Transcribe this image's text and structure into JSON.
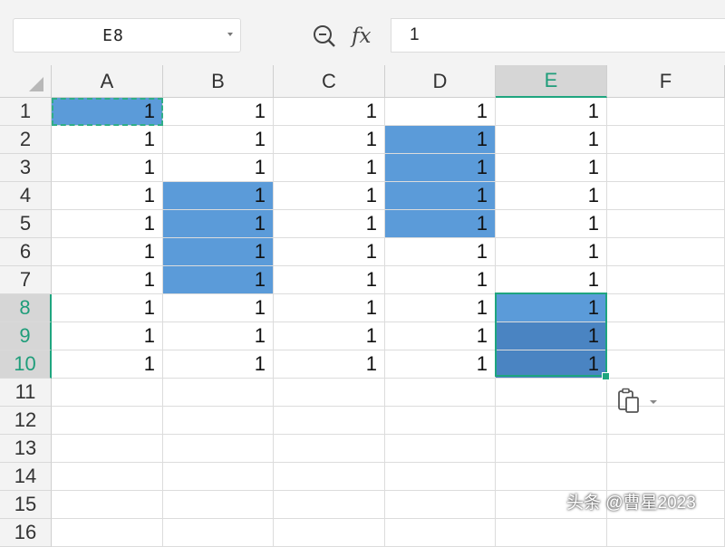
{
  "toolbar": {
    "name_box_value": "E8",
    "formula_value": "1",
    "zoom_icon": "magnifier-zoom-icon",
    "fx_label": "fx"
  },
  "sheet": {
    "columns": [
      "A",
      "B",
      "C",
      "D",
      "E",
      "F"
    ],
    "active_column": "E",
    "rows": [
      "1",
      "2",
      "3",
      "4",
      "5",
      "6",
      "7",
      "8",
      "9",
      "10",
      "11",
      "12",
      "13",
      "14",
      "15",
      "16"
    ],
    "active_rows": [
      "8",
      "9",
      "10"
    ],
    "cells": [
      [
        "1",
        "1",
        "1",
        "1",
        "1",
        ""
      ],
      [
        "1",
        "1",
        "1",
        "1",
        "1",
        ""
      ],
      [
        "1",
        "1",
        "1",
        "1",
        "1",
        ""
      ],
      [
        "1",
        "1",
        "1",
        "1",
        "1",
        ""
      ],
      [
        "1",
        "1",
        "1",
        "1",
        "1",
        ""
      ],
      [
        "1",
        "1",
        "1",
        "1",
        "1",
        ""
      ],
      [
        "1",
        "1",
        "1",
        "1",
        "1",
        ""
      ],
      [
        "1",
        "1",
        "1",
        "1",
        "1",
        ""
      ],
      [
        "1",
        "1",
        "1",
        "1",
        "1",
        ""
      ],
      [
        "1",
        "1",
        "1",
        "1",
        "1",
        ""
      ]
    ],
    "highlight_color": "#5b9bd9",
    "selection_color": "#1fa57f"
  },
  "paste_options_icon": "paste-clipboard-icon",
  "watermark": "头条 @曹星2023"
}
